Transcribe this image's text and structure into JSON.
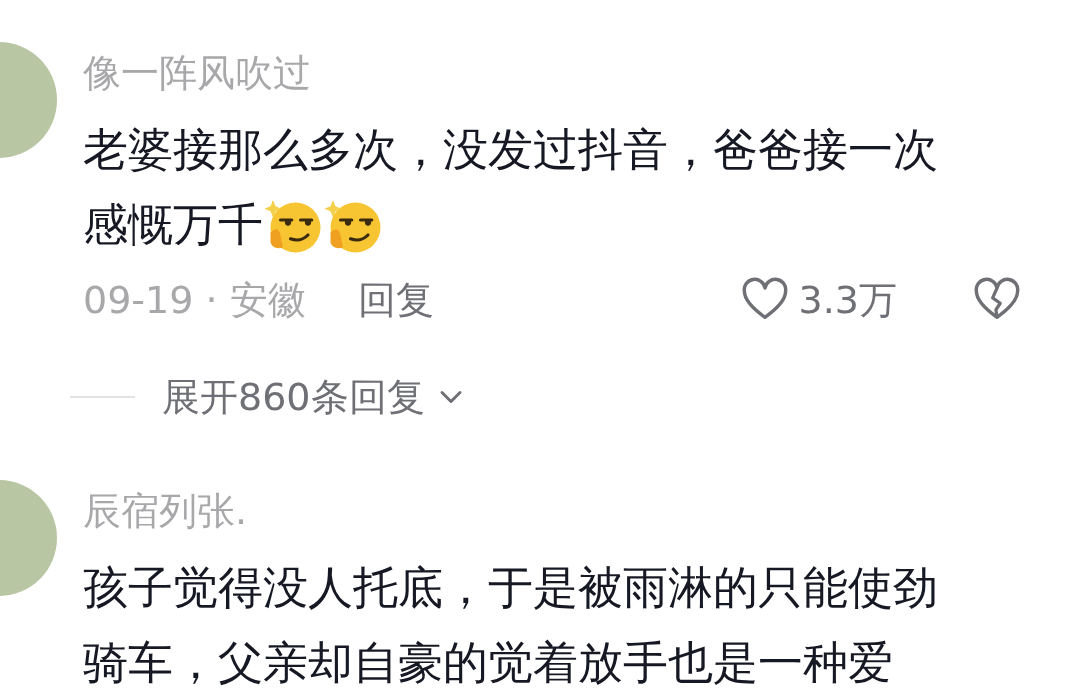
{
  "comments": [
    {
      "username": "像一阵风吹过",
      "lines": [
        [
          {
            "kind": "text",
            "text": "老婆接那么多次，没发过抖音，爸爸接一次"
          }
        ],
        [
          {
            "kind": "text",
            "text": "感慨万千"
          },
          {
            "kind": "emoji"
          },
          {
            "kind": "emoji"
          }
        ]
      ],
      "meta": "09-19 · 安徽",
      "reply": "回复",
      "likes": "3.3万",
      "expand": "展开860条回复"
    },
    {
      "username": "辰宿列张.",
      "lines": [
        [
          {
            "kind": "text",
            "text": "孩子觉得没人托底，于是被雨淋的只能使劲"
          }
        ],
        [
          {
            "kind": "text",
            "text": "骑车，父亲却自豪的觉着放手也是一种爱"
          }
        ]
      ]
    }
  ]
}
